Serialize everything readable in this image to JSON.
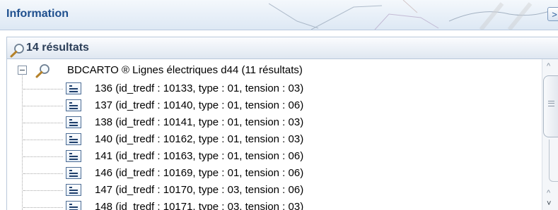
{
  "window": {
    "title": "Information",
    "collapse_glyph": ">"
  },
  "results_header": {
    "label": "14 résultats",
    "icon": "search-icon"
  },
  "tree": {
    "root": {
      "label": "BDCARTO ® Lignes électriques d44 (11 résultats)",
      "icon": "search-icon",
      "expanded": true
    },
    "items": [
      {
        "label": "136 (id_tredf : 10133, type : 01, tension : 03)"
      },
      {
        "label": "137 (id_tredf : 10140, type : 01, tension : 06)"
      },
      {
        "label": "138 (id_tredf : 10141, type : 01, tension : 03)"
      },
      {
        "label": "140 (id_tredf : 10162, type : 01, tension : 03)"
      },
      {
        "label": "141 (id_tredf : 10163, type : 01, tension : 06)"
      },
      {
        "label": "146 (id_tredf : 10169, type : 01, tension : 06)"
      },
      {
        "label": "147 (id_tredf : 10170, type : 03, tension : 06)"
      },
      {
        "label": "148 (id_tredf : 10171, type : 03, tension : 03)"
      }
    ]
  },
  "scrollbar": {
    "up_glyph": "^",
    "down_glyph": "^",
    "down2_glyph": "˅"
  },
  "colors": {
    "title": "#1e4f8e",
    "header_border": "#b9c8da",
    "icon_blue": "#4d6d95"
  }
}
